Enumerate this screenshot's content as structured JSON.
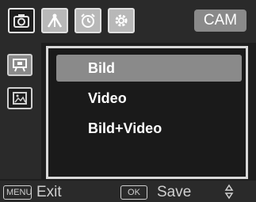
{
  "top_tabs": [
    {
      "icon": "camera-icon",
      "state": "active"
    },
    {
      "icon": "tools-icon",
      "state": "inactive"
    },
    {
      "icon": "alarm-clock-icon",
      "state": "inactive"
    },
    {
      "icon": "gear-icon",
      "state": "inactive"
    }
  ],
  "mode_badge": "CAM",
  "sidebar": [
    {
      "icon": "video-camera-icon",
      "selected": true
    },
    {
      "icon": "image-icon",
      "selected": false
    }
  ],
  "menu": {
    "items": [
      {
        "label": "Bild",
        "selected": true
      },
      {
        "label": "Video",
        "selected": false
      },
      {
        "label": "Bild+Video",
        "selected": false
      }
    ]
  },
  "bottom": {
    "menu_key": "MENU",
    "exit_label": "Exit",
    "ok_key": "OK",
    "save_label": "Save",
    "nav_icon": "up-down-arrows-icon"
  },
  "colors": {
    "background": "#1e1e1e",
    "selection": "#8a8a8a",
    "text": "#ffffff",
    "border": "#d8d8d8"
  }
}
